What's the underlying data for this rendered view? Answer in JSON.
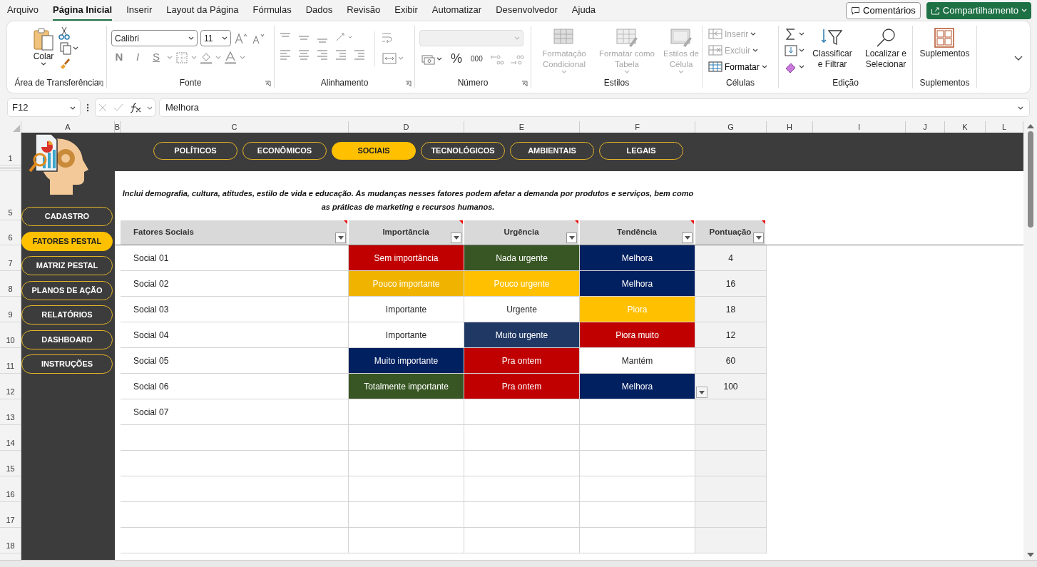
{
  "menu_tabs": [
    {
      "label": "Arquivo",
      "selected": false
    },
    {
      "label": "Página Inicial",
      "selected": true
    },
    {
      "label": "Inserir",
      "selected": false
    },
    {
      "label": "Layout da Página",
      "selected": false
    },
    {
      "label": "Fórmulas",
      "selected": false
    },
    {
      "label": "Dados",
      "selected": false
    },
    {
      "label": "Revisão",
      "selected": false
    },
    {
      "label": "Exibir",
      "selected": false
    },
    {
      "label": "Automatizar",
      "selected": false
    },
    {
      "label": "Desenvolvedor",
      "selected": false
    },
    {
      "label": "Ajuda",
      "selected": false
    }
  ],
  "comments_button": "Comentários",
  "share_button": "Compartilhamento",
  "ribbon": {
    "clipboard": {
      "paste": "Colar",
      "label": "Área de Transferência"
    },
    "font": {
      "name": "Calibri",
      "size": "11",
      "bold": "N",
      "italic": "I",
      "underline": "S",
      "label": "Fonte"
    },
    "alignment": {
      "label": "Alinhamento"
    },
    "number": {
      "format_box": {
        "disabled": true
      },
      "percent": "%",
      "thousands": "000",
      "label": "Número"
    },
    "styles": {
      "items": [
        {
          "label": "Formatação Condicional",
          "disabled": true
        },
        {
          "label": "Formatar como Tabela",
          "disabled": true
        },
        {
          "label": "Estilos de Célula",
          "disabled": true
        }
      ],
      "label": "Estilos"
    },
    "cells": {
      "items": [
        {
          "label": "Inserir",
          "disabled": true
        },
        {
          "label": "Excluir",
          "disabled": true
        },
        {
          "label": "Formatar",
          "disabled": false
        }
      ],
      "label": "Células"
    },
    "editing": {
      "sort": "Classificar e Filtrar",
      "find": "Localizar e Selecionar",
      "label": "Edição"
    },
    "addins": {
      "button": "Suplementos",
      "label": "Suplementos"
    }
  },
  "formula_bar": {
    "name_box": "F12",
    "formula": "Melhora"
  },
  "column_headers": [
    "A",
    "B",
    "C",
    "D",
    "E",
    "F",
    "G",
    "H",
    "I",
    "J",
    "K",
    "L"
  ],
  "row_headers": [
    "1",
    "5",
    "6",
    "7",
    "8",
    "9",
    "10",
    "11",
    "12",
    "13",
    "14",
    "15",
    "16",
    "17",
    "18"
  ],
  "pestal_tabs": [
    {
      "label": "POLÍTICOS",
      "selected": false
    },
    {
      "label": "ECONÔMICOS",
      "selected": false
    },
    {
      "label": "SOCIAIS",
      "selected": true
    },
    {
      "label": "TECNOLÓGICOS",
      "selected": false
    },
    {
      "label": "AMBIENTAIS",
      "selected": false
    },
    {
      "label": "LEGAIS",
      "selected": false
    }
  ],
  "nav_items": [
    {
      "label": "CADASTRO",
      "selected": false
    },
    {
      "label": "FATORES PESTAL",
      "selected": true
    },
    {
      "label": "MATRIZ PESTAL",
      "selected": false
    },
    {
      "label": "PLANOS DE AÇÃO",
      "selected": false
    },
    {
      "label": "RELATÓRIOS",
      "selected": false
    },
    {
      "label": "DASHBOARD",
      "selected": false
    },
    {
      "label": "INSTRUÇÕES",
      "selected": false
    }
  ],
  "description": "Inclui demografia, cultura, atitudes, estilo de vida e educação. As mudanças nesses fatores podem afetar a demanda por produtos e serviços, bem como as práticas de marketing e recursos humanos.",
  "table": {
    "columns": [
      {
        "label": "Fatores Sociais",
        "comment": true
      },
      {
        "label": "Importância",
        "comment": true
      },
      {
        "label": "Urgência",
        "comment": true
      },
      {
        "label": "Tendência",
        "comment": true
      },
      {
        "label": "Pontuação",
        "comment": true
      }
    ],
    "rows": [
      {
        "factor": "Social 01",
        "importance": {
          "text": "Sem importância",
          "color": "#c00000"
        },
        "urgency": {
          "text": "Nada urgente",
          "color": "#375623"
        },
        "trend": {
          "text": "Melhora",
          "color": "#002060"
        },
        "score": "4",
        "active": false
      },
      {
        "factor": "Social 02",
        "importance": {
          "text": "Pouco importante",
          "color": "#f0b400"
        },
        "urgency": {
          "text": "Pouco urgente",
          "color": "#ffc000"
        },
        "trend": {
          "text": "Melhora",
          "color": "#002060"
        },
        "score": "16",
        "active": false
      },
      {
        "factor": "Social 03",
        "importance": {
          "text": "Importante"
        },
        "urgency": {
          "text": "Urgente"
        },
        "trend": {
          "text": "Piora",
          "color": "#ffc000"
        },
        "score": "18",
        "active": false
      },
      {
        "factor": "Social 04",
        "importance": {
          "text": "Importante"
        },
        "urgency": {
          "text": "Muito urgente",
          "color": "#203864"
        },
        "trend": {
          "text": "Piora muito",
          "color": "#c00000"
        },
        "score": "12",
        "active": false
      },
      {
        "factor": "Social 05",
        "importance": {
          "text": "Muito importante",
          "color": "#002060"
        },
        "urgency": {
          "text": "Pra ontem",
          "color": "#c00000"
        },
        "trend": {
          "text": "Mantém"
        },
        "score": "60",
        "active": false
      },
      {
        "factor": "Social 06",
        "importance": {
          "text": "Totalmente importante",
          "color": "#375623"
        },
        "urgency": {
          "text": "Pra ontem",
          "color": "#c00000"
        },
        "trend": {
          "text": "Melhora",
          "color": "#002060"
        },
        "score": "100",
        "active": true
      },
      {
        "factor": "Social 07",
        "active": false
      }
    ]
  }
}
